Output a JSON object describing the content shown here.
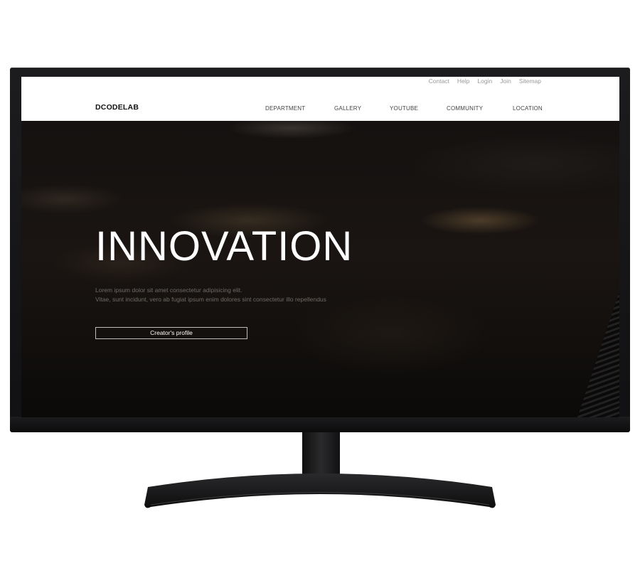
{
  "site": {
    "logo": "DCODELAB",
    "util_links": [
      "Contact",
      "Help",
      "Login",
      "Join",
      "Sitemap"
    ],
    "nav": [
      "DEPARTMENT",
      "GALLERY",
      "YOUTUBE",
      "COMMUNITY",
      "LOCATION"
    ]
  },
  "hero": {
    "title": "INNOVATION",
    "desc_line1": "Lorem ipsum dolor sit amet consectetur adipisicing elit.",
    "desc_line2": "Vitae, sunt incidunt, vero ab fugiat ipsum enim dolores sint consectetur illo repellendus",
    "button_label": "Creator's profile"
  },
  "colors": {
    "monitor": "#151517",
    "header_bg": "#ffffff",
    "hero_bg": "#141110",
    "title": "#ffffff"
  }
}
